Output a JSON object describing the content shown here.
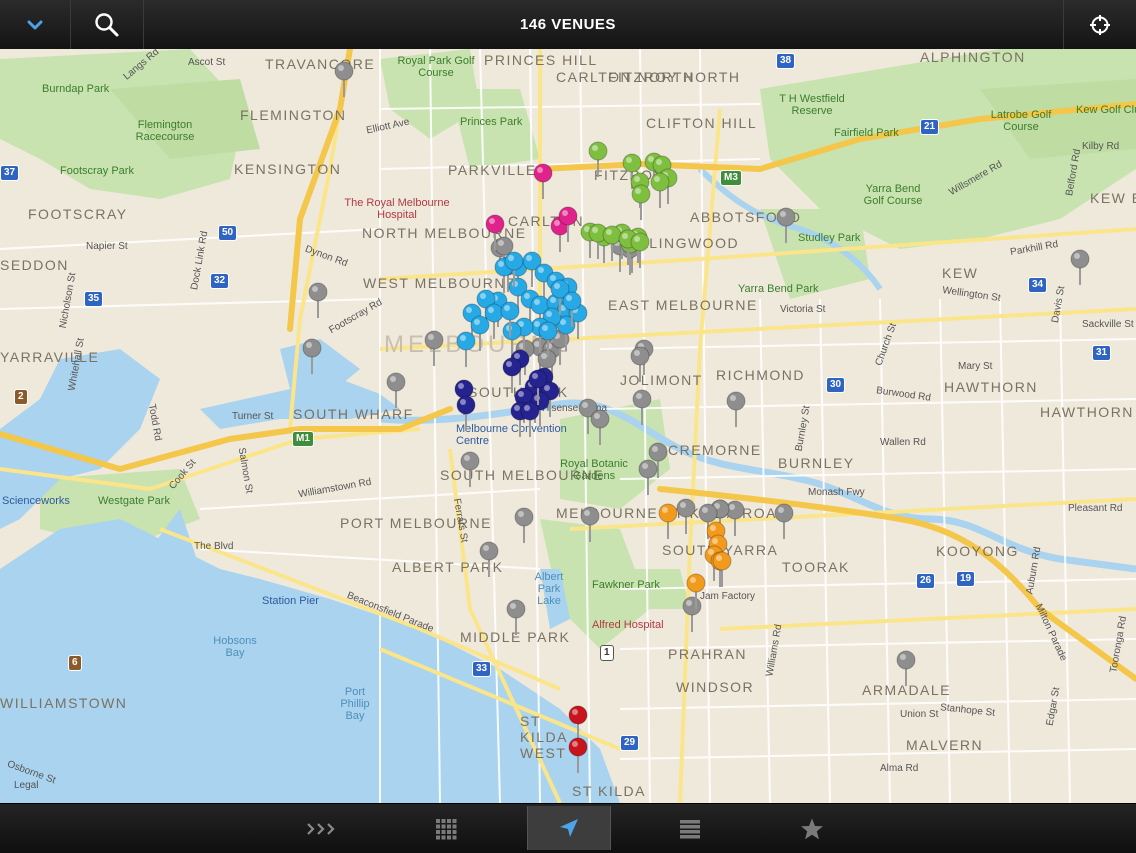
{
  "header": {
    "title": "146 VENUES",
    "menu_icon": "chevron-down-icon",
    "search_icon": "search-icon",
    "locate_icon": "crosshair-icon"
  },
  "map": {
    "suburbs": [
      "TRAVANCORE",
      "FLEMINGTON",
      "KENSINGTON",
      "FOOTSCRAY",
      "SEDDON",
      "NORTH MELBOURNE",
      "WEST MELBOURNE",
      "PARKVILLE",
      "CARLTON",
      "PRINCES HILL",
      "CARLTON NORTH",
      "FITZROY NORTH",
      "FITZROY",
      "CLIFTON HILL",
      "ALPHINGTON",
      "ABBOTSFORD",
      "COLLINGWOOD",
      "EAST MELBOURNE",
      "MELBOURNE",
      "JOLIMONT",
      "RICHMOND",
      "KEW",
      "KEW EAST",
      "HAWTHORN",
      "HAWTHORN EAST",
      "BURNLEY",
      "CREMORNE",
      "SOUTH WHARF",
      "SOUTHBANK",
      "SOUTH MELBOURNE",
      "PORT MELBOURNE",
      "ALBERT PARK",
      "MIDDLE PARK",
      "MELBOURNE ST KILDA ROAD",
      "SOUTH YARRA",
      "TOORAK",
      "KOOYONG",
      "PRAHRAN",
      "WINDSOR",
      "ARMADALE",
      "MALVERN",
      "ST KILDA WEST",
      "ST KILDA",
      "WILLIAMSTOWN",
      "YARRAVILLE"
    ],
    "parks": [
      "Royal Park Golf Course",
      "Burndap Park",
      "Flemington Racecourse",
      "Footscray Park",
      "Princes Park",
      "T H Westfield Reserve",
      "Fairfield Park",
      "Latrobe Golf Course",
      "Kew Golf Club",
      "Yarra Bend Golf Course",
      "Studley Park",
      "Yarra Bend Park",
      "Royal Botanic Gardens",
      "Fawkner Park",
      "Albert Park Lake",
      "Westgate Park"
    ],
    "water": [
      "Hobsons Bay",
      "Port Phillip Bay"
    ],
    "roads": [
      "Ascot St",
      "Langs Rd",
      "Elliott Ave",
      "Dynon Rd",
      "Napier St",
      "Nicholson St",
      "Whitehall St",
      "Dock Link Rd",
      "Footscray Rd",
      "Turner St",
      "Todd Rd",
      "Cook St",
      "Salmon St",
      "Williamstown Rd",
      "The Blvd",
      "Beaconsfield Parade",
      "Ferrars St",
      "Kilby Rd",
      "Belford Rd",
      "Willsmere Rd",
      "Wellington St",
      "Parkhill Rd",
      "Victoria St",
      "Church St",
      "Mary St",
      "Burwood Rd",
      "Davis St",
      "Sackville St",
      "Wallen Rd",
      "Monash Fwy",
      "Pleasant Rd",
      "Auburn Rd",
      "Milton Parade",
      "Williams Rd",
      "Union St",
      "Stanhope St",
      "Alma Rd",
      "Osborne St",
      "Burnley St",
      "Edgar St",
      "Tooronga Rd"
    ],
    "pois": [
      "The Royal Melbourne Hospital",
      "Melbourne Convention Centre",
      "Scienceworks",
      "Station Pier",
      "Alfred Hospital",
      "Jam Factory",
      "Hisense Arena"
    ],
    "route_shields": [
      "37",
      "50",
      "32",
      "35",
      "30",
      "21",
      "34",
      "26",
      "19",
      "33",
      "29",
      "38",
      "31",
      "M1",
      "M3",
      "1",
      "2",
      "6"
    ],
    "legal_label": "Legal"
  },
  "pins": {
    "colors": {
      "gray": "#8e8e8e",
      "pink": "#e0238a",
      "green": "#7fbf3f",
      "cyan": "#27a9e6",
      "navy": "#25238f",
      "orange": "#f29a1c",
      "red": "#c8141c"
    },
    "counts": {
      "gray": 40,
      "pink": 4,
      "green": 17,
      "cyan": 29,
      "navy": 12,
      "orange": 7,
      "red": 2
    }
  },
  "toolbar": {
    "items": [
      {
        "name": "more-icon",
        "active": false
      },
      {
        "name": "grid-icon",
        "active": false
      },
      {
        "name": "location-arrow-icon",
        "active": true
      },
      {
        "name": "list-icon",
        "active": false
      },
      {
        "name": "star-icon",
        "active": false
      }
    ]
  },
  "colors": {
    "water": "#a9d3ee",
    "park": "#c8e3b0",
    "land": "#efe9dc",
    "freeway": "#f4c64a",
    "road": "#fff6c9",
    "bar": "#1a1a1a",
    "active_icon": "#4da3e8"
  }
}
